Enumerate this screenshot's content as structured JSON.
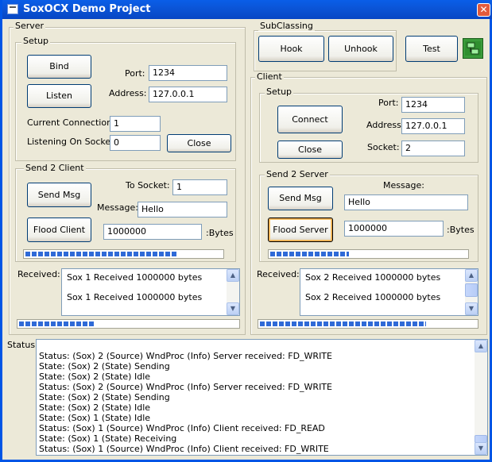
{
  "window": {
    "title": "SoxOCX Demo Project",
    "close_glyph": "✕"
  },
  "server": {
    "frame_label": "Server",
    "setup": {
      "frame_label": "Setup",
      "bind_label": "Bind",
      "listen_label": "Listen",
      "port_label": "Port:",
      "port_value": "1234",
      "address_label": "Address:",
      "address_value": "127.0.0.1",
      "current_connections_label": "Current Connections:",
      "current_connections_value": "1",
      "listening_socket_label": "Listening On Socket:",
      "listening_socket_value": "0",
      "close_label": "Close"
    },
    "send": {
      "frame_label": "Send 2 Client",
      "send_msg_label": "Send Msg",
      "to_socket_label": "To Socket:",
      "to_socket_value": "1",
      "message_label": "Message:",
      "message_value": "Hello",
      "flood_label": "Flood Client",
      "bytes_value": "1000000",
      "bytes_unit": ":Bytes",
      "progress": 0.77
    },
    "received_label": "Received:",
    "received_items": [
      "Sox 1 Received 1000000 bytes",
      "Sox 1 Received 1000000 bytes"
    ],
    "received_progress": 0.34
  },
  "subclassing": {
    "frame_label": "SubClassing",
    "hook_label": "Hook",
    "unhook_label": "Unhook"
  },
  "test_label": "Test",
  "network_icon": "network-connection-icon",
  "client": {
    "frame_label": "Client",
    "setup": {
      "frame_label": "Setup",
      "connect_label": "Connect",
      "close_label": "Close",
      "port_label": "Port:",
      "port_value": "1234",
      "address_label": "Address:",
      "address_value": "127.0.0.1",
      "socket_label": "Socket:",
      "socket_value": "2"
    },
    "send": {
      "frame_label": "Send 2 Server",
      "message_label": "Message:",
      "send_msg_label": "Send Msg",
      "message_value": "Hello",
      "flood_label": "Flood Server",
      "bytes_value": "1000000",
      "bytes_unit": ":Bytes",
      "progress": 0.4
    },
    "received_label": "Received:",
    "received_items": [
      "Sox 2 Received 1000000 bytes",
      "Sox 2 Received 1000000 bytes"
    ],
    "received_progress": 0.77
  },
  "status": {
    "label": "Status:",
    "lines": [
      "Status: (Sox) 2 (Source) WndProc (Info) Server received: FD_WRITE",
      "State: (Sox) 2 (State) Sending",
      "State: (Sox) 2 (State) Idle",
      "Status: (Sox) 2 (Source) WndProc (Info) Server received: FD_WRITE",
      "State: (Sox) 2 (State) Sending",
      "State: (Sox) 2 (State) Idle",
      "State: (Sox) 1 (State) Idle",
      "Status: (Sox) 1 (Source) WndProc (Info) Client received: FD_READ",
      "State: (Sox) 1 (State) Receiving",
      "Status: (Sox) 1 (Source) WndProc (Info) Client received: FD_WRITE"
    ]
  },
  "colors": {
    "titlebar": "#0054e3",
    "face": "#ece9d8",
    "progress": "#2f6ad7"
  }
}
